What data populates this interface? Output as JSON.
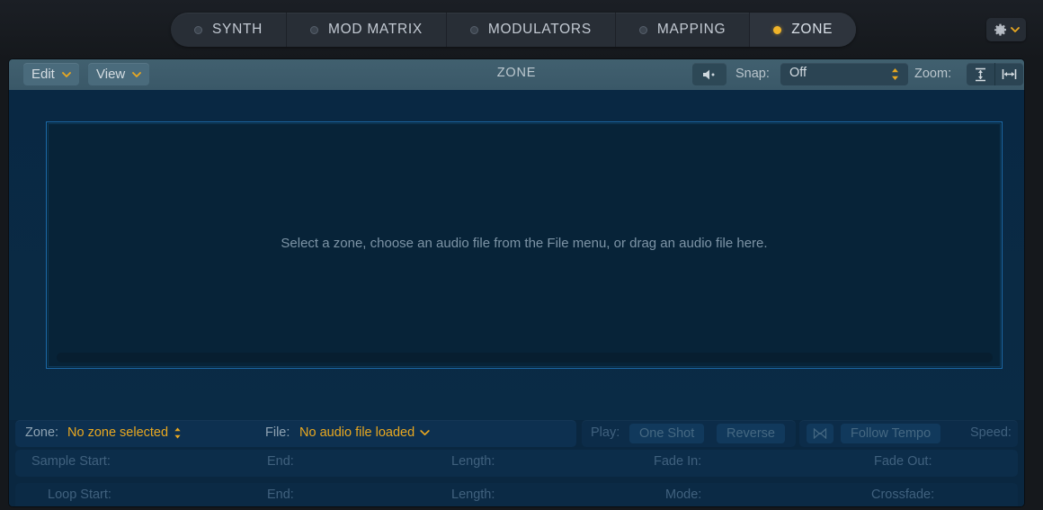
{
  "window": {
    "background": "#15181c",
    "panel_bg": "#0a2740",
    "accent": "#e9a820",
    "toolbar_bg": "#3e5d6d"
  },
  "tabs": [
    {
      "label": "SYNTH",
      "active": false,
      "dot": "ring-dot-icon"
    },
    {
      "label": "MOD MATRIX",
      "active": false,
      "dot": "ring-dot-icon"
    },
    {
      "label": "MODULATORS",
      "active": false,
      "dot": "ring-dot-icon"
    },
    {
      "label": "MAPPING",
      "active": false,
      "dot": "ring-dot-icon"
    },
    {
      "label": "ZONE",
      "active": true,
      "dot": "filled-dot-icon"
    }
  ],
  "settings_button": {
    "icon": "gear-icon",
    "chevron": "chevron-down-icon"
  },
  "toolbar": {
    "edit_menu": "Edit",
    "view_menu": "View",
    "title": "ZONE",
    "speaker_icon": "speaker-icon",
    "snap_label": "Snap:",
    "snap_value": "Off",
    "snap_options": [
      "Off"
    ],
    "zoom_label": "Zoom:",
    "zoom_vertical_icon": "zoom-fit-vertical-icon",
    "zoom_horizontal_icon": "zoom-fit-horizontal-icon",
    "menu_chevron": "chevron-down-icon"
  },
  "waveform": {
    "placeholder": "Select a zone, choose an audio file from the File menu, or drag an audio file here."
  },
  "info": {
    "zone_label": "Zone:",
    "zone_value": "No zone selected",
    "zone_stepper_icon": "updown-arrows-icon",
    "file_label": "File:",
    "file_value": "No audio file loaded",
    "file_chevron_icon": "chevron-down-icon",
    "play_label": "Play:",
    "play_one_shot": "One Shot",
    "play_reverse": "Reverse",
    "tempo_icon": "tempo-sync-icon",
    "follow_tempo": "Follow Tempo",
    "speed_label": "Speed:"
  },
  "sample_row": {
    "start": "Sample Start:",
    "end": "End:",
    "length": "Length:",
    "fade_in": "Fade In:",
    "fade_out": "Fade Out:"
  },
  "loop_row": {
    "start": "Loop Start:",
    "end": "End:",
    "length": "Length:",
    "mode": "Mode:",
    "crossfade": "Crossfade:"
  }
}
